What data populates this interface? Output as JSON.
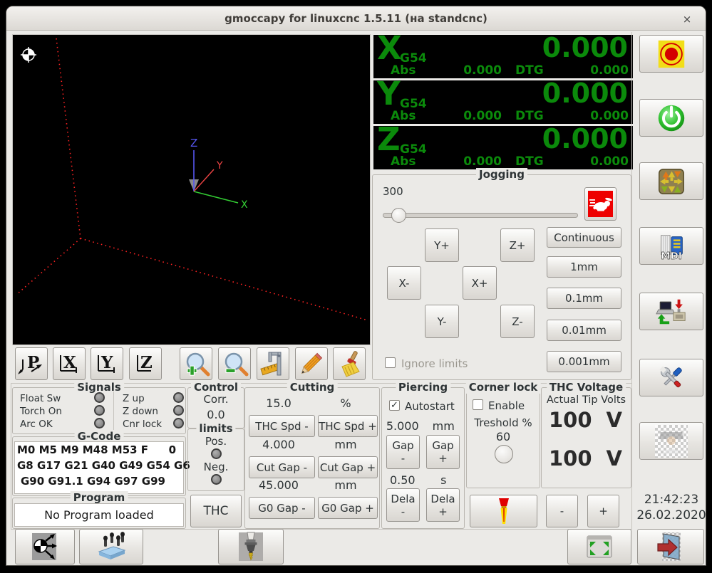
{
  "window": {
    "title": "gmoccapy for linuxcnc  1.5.11 (на standcnc)",
    "close_glyph": "×"
  },
  "colors": {
    "dro_green": "#0b8a0b",
    "dro_bg": "#000000",
    "estop_yellow": "#f2de18",
    "estop_red": "#d40000",
    "power_green": "#2fc12f",
    "rabbit_red": "#ee0000",
    "axis_x_green": "#33cc33",
    "axis_y_red": "#ee4444",
    "axis_z_blue": "#5555ee",
    "limit_line_red": "#ff2222"
  },
  "preview": {
    "axis_x": "X",
    "axis_y": "Y",
    "axis_z": "Z"
  },
  "preview_toolbar": {
    "p": "P",
    "x": "X",
    "y": "Y",
    "z": "Z"
  },
  "dro": {
    "axes": [
      {
        "letter": "X",
        "system": "G54",
        "value": "0.000",
        "abs_label": "Abs",
        "abs_value": "0.000",
        "dtg_label": "DTG",
        "dtg_value": "0.000"
      },
      {
        "letter": "Y",
        "system": "G54",
        "value": "0.000",
        "abs_label": "Abs",
        "abs_value": "0.000",
        "dtg_label": "DTG",
        "dtg_value": "0.000"
      },
      {
        "letter": "Z",
        "system": "G54",
        "value": "0.000",
        "abs_label": "Abs",
        "abs_value": "0.000",
        "dtg_label": "DTG",
        "dtg_value": "0.000"
      }
    ]
  },
  "jogging": {
    "title": "Jogging",
    "speed_value": "300",
    "jog_buttons": {
      "y_plus": "Y+",
      "z_plus": "Z+",
      "x_minus": "X-",
      "x_plus": "X+",
      "y_minus": "Y-",
      "z_minus": "Z-"
    },
    "increments": [
      "Continuous",
      "1mm",
      "0.1mm",
      "0.01mm",
      "0.001mm"
    ],
    "ignore_limits_label": "Ignore limits",
    "ignore_limits_checked": false
  },
  "signals": {
    "title": "Signals",
    "left": [
      {
        "label": "Float Sw"
      },
      {
        "label": "Torch On"
      },
      {
        "label": "Arc OK"
      }
    ],
    "right": [
      {
        "label": "Z up"
      },
      {
        "label": "Z down"
      },
      {
        "label": "Cnr lock"
      }
    ]
  },
  "control": {
    "title": "Control",
    "corr_label": "Corr.",
    "corr_value": "0.0",
    "limits_title": "limits",
    "pos_label": "Pos.",
    "neg_label": "Neg.",
    "thc_label": "THC"
  },
  "gcode": {
    "title": "G-Code",
    "line1_left": "M0 M5 M9 M48 M53 F",
    "line1_right": "0",
    "line2": "G8 G17 G21 G40 G49 G54 G6",
    "line3": "G90 G91.1 G94 G97 G99"
  },
  "program": {
    "title": "Program",
    "status": "No Program loaded"
  },
  "cutting": {
    "title": "Cutting",
    "rows": [
      {
        "value": "15.0",
        "unit": "%",
        "minus": "THC Spd -",
        "plus": "THC Spd +"
      },
      {
        "value": "4.000",
        "unit": "mm",
        "minus": "Cut Gap -",
        "plus": "Cut Gap +"
      },
      {
        "value": "45.000",
        "unit": "mm",
        "minus": "G0 Gap -",
        "plus": "G0 Gap +"
      }
    ]
  },
  "piercing": {
    "title": "Piercing",
    "autostart_label": "Autostart",
    "autostart_checked": true,
    "gap_value": "5.000",
    "gap_unit": "mm",
    "gap_label": "Gap",
    "delay_value": "0.50",
    "delay_unit": "s",
    "delay_label": "Dela",
    "minus": "-",
    "plus": "+"
  },
  "corner_lock": {
    "title": "Corner lock",
    "enable_label": "Enable",
    "enable_checked": false,
    "threshold_label": "Treshold %",
    "threshold_value": "60"
  },
  "thc_voltage": {
    "title": "THC Voltage",
    "subtitle": "Actual Tip Volts",
    "value_top": "100",
    "value_bottom": "100",
    "unit": "V",
    "minus": "-",
    "plus": "+"
  },
  "sidebar": {
    "mdi_label": "MDI"
  },
  "clock": {
    "time": "21:42:23",
    "date": "26.02.2020"
  },
  "icons": [
    "emergency-stop",
    "machine-on",
    "manual-mode-jog-pad",
    "mdi-mode",
    "auto-mode",
    "settings-tools",
    "user-tab",
    "rabbit-jog-speed",
    "torch",
    "fullscreen",
    "exit",
    "touch-off",
    "touch-plate",
    "tool-change",
    "zoom-in",
    "zoom-out",
    "dimensions",
    "pencil",
    "clear-view",
    "origin-marker"
  ],
  "checkmark": "✓"
}
